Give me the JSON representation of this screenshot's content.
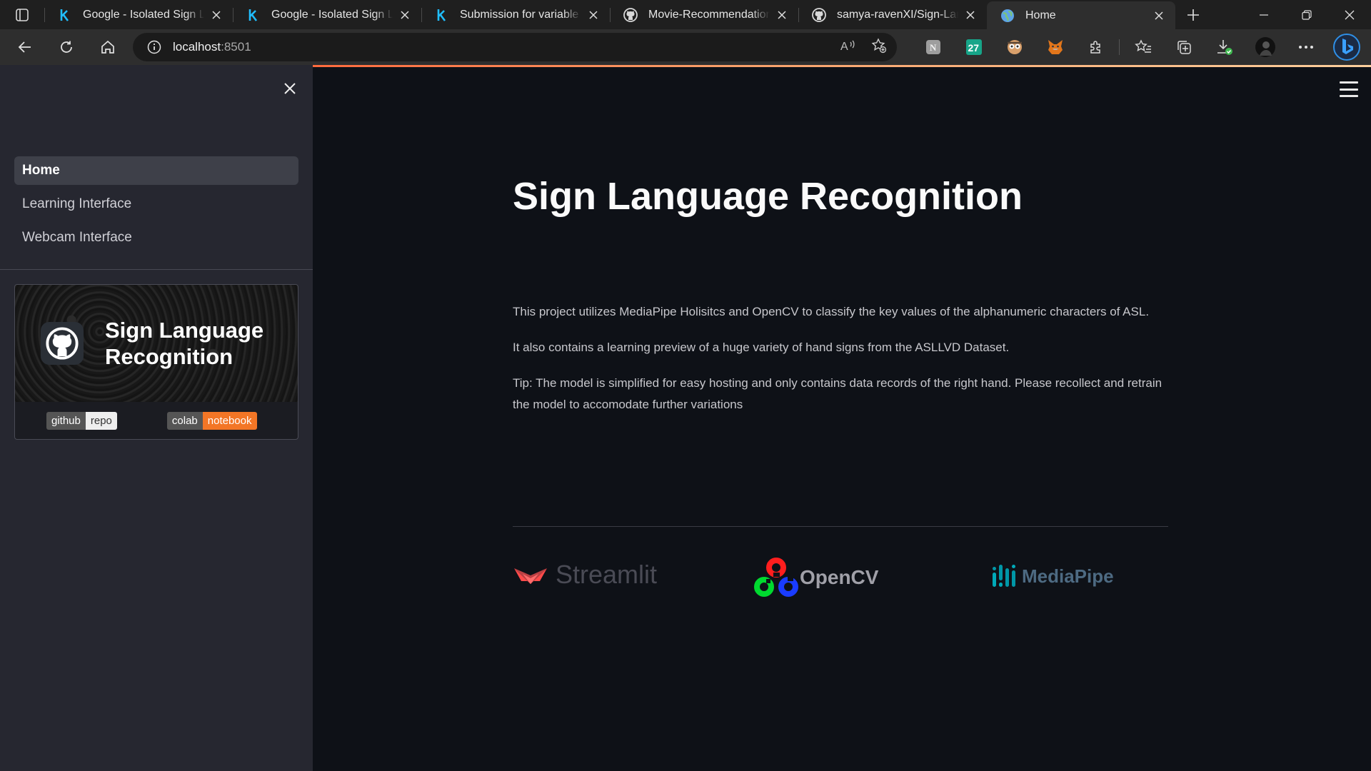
{
  "browser": {
    "tabs": [
      {
        "title": "Google - Isolated Sign Language",
        "favicon": "kaggle-icon",
        "active": false
      },
      {
        "title": "Google - Isolated Sign Language",
        "favicon": "kaggle-icon",
        "active": false
      },
      {
        "title": "Submission for variable length",
        "favicon": "kaggle-icon",
        "active": false
      },
      {
        "title": "Movie-Recommendation-System",
        "favicon": "github-icon",
        "active": false
      },
      {
        "title": "samya-ravenXI/Sign-Language",
        "favicon": "github-icon",
        "active": false
      },
      {
        "title": "Home",
        "favicon": "globe-icon",
        "active": true
      }
    ],
    "address": {
      "host": "localhost",
      "port": ":8501"
    },
    "toolbar_badge": "27",
    "load_gradient": [
      "#ff6a3d",
      "#fccf9c"
    ]
  },
  "sidebar": {
    "nav": [
      {
        "label": "Home",
        "active": true
      },
      {
        "label": "Learning Interface",
        "active": false
      },
      {
        "label": "Webcam Interface",
        "active": false
      }
    ],
    "card": {
      "title_line1": "Sign Language",
      "title_line2": "Recognition",
      "badges": [
        {
          "left": "github",
          "right": "repo",
          "color": "#eeeeee"
        },
        {
          "left": "colab",
          "right": "notebook",
          "color": "#f37626"
        }
      ]
    }
  },
  "main": {
    "title": "Sign Language Recognition",
    "paragraphs": [
      "This project utilizes MediaPipe Holisitcs and OpenCV to classify the key values of the alphanumeric characters of ASL.",
      "It also contains a learning preview of a huge variety of hand signs from the ASLLVD Dataset.",
      "Tip: The model is simplified for easy hosting and only contains data records of the right hand. Please recollect and retrain the model to accomodate further variations"
    ],
    "logos": [
      {
        "name": "Streamlit",
        "color": "#ff4b4b"
      },
      {
        "name": "OpenCV",
        "color": "#a0a0a8"
      },
      {
        "name": "MediaPipe",
        "color": "#0097a7"
      }
    ]
  }
}
